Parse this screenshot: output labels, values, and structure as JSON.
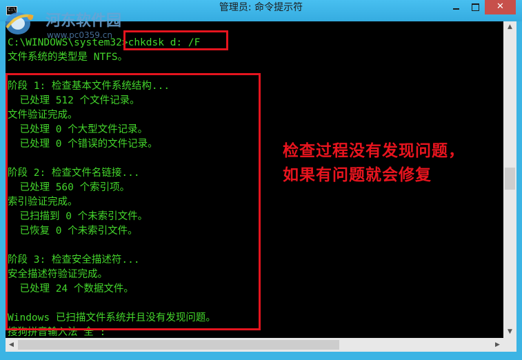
{
  "window": {
    "title": "管理员: 命令提示符",
    "icon_text": "C:\\",
    "close_label": "✕"
  },
  "watermark": {
    "title": "河东软件园",
    "url": "www.pc0359.cn"
  },
  "console": {
    "lines": [
      "C:\\WINDOWS\\system32>chkdsk d: /F",
      "文件系统的类型是 NTFS。",
      "",
      "阶段 1: 检查基本文件系统结构...",
      "  已处理 512 个文件记录。",
      "文件验证完成。",
      "  已处理 0 个大型文件记录。",
      "  已处理 0 个错误的文件记录。",
      "",
      "阶段 2: 检查文件名链接...",
      "  已处理 560 个索引项。",
      "索引验证完成。",
      "  已扫描到 0 个未索引文件。",
      "  已恢复 0 个未索引文件。",
      "",
      "阶段 3: 检查安全描述符...",
      "安全描述符验证完成。",
      "  已处理 24 个数据文件。",
      "",
      "Windows 已扫描文件系统并且没有发现问题。",
      "搜狗拼音输入法 全 :"
    ]
  },
  "annotation": {
    "lines": [
      "检查过程没有发现问题，",
      "如果有问题就会修复"
    ]
  },
  "colors": {
    "console_text": "#44d62c",
    "console_bg": "#000000",
    "titlebar": "#3cb4e4",
    "annotation": "#e8141e",
    "close_button": "#c7504b"
  },
  "icons": {
    "window": "cmd-console-icon",
    "minimize": "minimize-icon",
    "maximize": "maximize-icon",
    "close": "close-icon",
    "watermark": "hedong-logo-icon"
  }
}
